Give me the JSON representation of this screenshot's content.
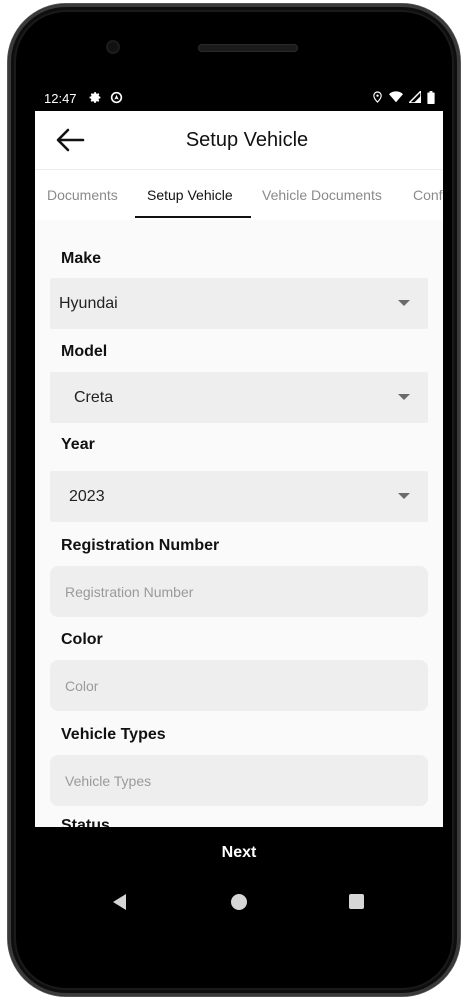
{
  "status": {
    "time": "12:47",
    "left_icons": [
      "gear-icon",
      "location-icon"
    ],
    "right_icons": [
      "location-pin-icon",
      "wifi-icon",
      "signal-icon",
      "battery-icon"
    ]
  },
  "appbar": {
    "title": "Setup Vehicle",
    "back_icon": "arrow-left-icon"
  },
  "tabs": [
    "Documents",
    "Setup Vehicle",
    "Vehicle Documents",
    "Conf"
  ],
  "active_tab": "Setup Vehicle",
  "form": {
    "make": {
      "label": "Make",
      "value": "Hyundai"
    },
    "model": {
      "label": "Model",
      "value": "Creta"
    },
    "year": {
      "label": "Year",
      "value": "2023"
    },
    "registration": {
      "label": "Registration Number",
      "placeholder": "Registration Number"
    },
    "color": {
      "label": "Color",
      "placeholder": "Color"
    },
    "vehicle_types": {
      "label": "Vehicle Types",
      "placeholder": "Vehicle Types"
    },
    "status": {
      "label": "Status"
    }
  },
  "footer": {
    "next_label": "Next"
  },
  "colors": {
    "background": "#fafafa",
    "field": "#eeeeee",
    "accent": "#111111"
  }
}
